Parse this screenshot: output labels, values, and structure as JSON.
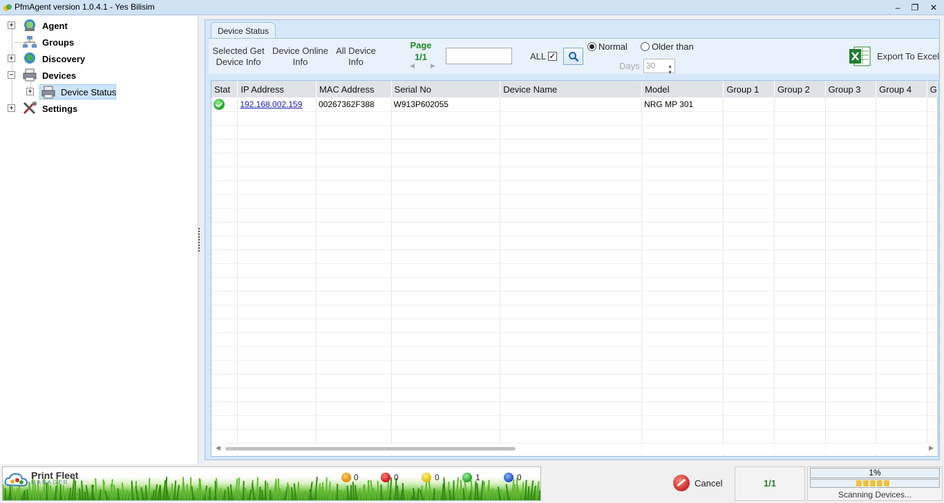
{
  "window": {
    "title": "PfmAgent version 1.0.4.1 - Yes Bilisim",
    "minimize": "–",
    "restore": "❐",
    "close": "✕"
  },
  "tree": [
    {
      "label": "Agent",
      "expander": "+"
    },
    {
      "label": "Groups"
    },
    {
      "label": "Discovery",
      "expander": "+"
    },
    {
      "label": "Devices",
      "expander": "−"
    },
    {
      "label": "Device Status",
      "expander": "+"
    },
    {
      "label": "Settings",
      "expander": "+"
    }
  ],
  "tab": {
    "label": "Device Status"
  },
  "toolbar": {
    "selected_get_1": "Selected Get",
    "selected_get_2": "Device Info",
    "device_online_1": "Device Online",
    "device_online_2": "Info",
    "all_device_1": "All Device",
    "all_device_2": "Info",
    "page_label": "Page",
    "page_value": "1/1",
    "page_prev": "◀",
    "page_next": "▶",
    "search_value": "",
    "all_label": "ALL",
    "all_checked": "✓",
    "normal_label": "Normal",
    "older_label": "Older than",
    "days_label": "Days",
    "days_value": "30",
    "export_label": "Export To Excel"
  },
  "grid": {
    "columns": [
      "Stat",
      "IP Address",
      "MAC Address",
      "Serial No",
      "Device Name",
      "Model",
      "Group 1",
      "Group 2",
      "Group 3",
      "Group 4",
      "G"
    ],
    "rows": [
      {
        "status": "ok",
        "ip": "192.168.002.159",
        "mac": "00267362F388",
        "serial": "W913P602055",
        "name": "",
        "model": "NRG MP 301",
        "g1": "",
        "g2": "",
        "g3": "",
        "g4": ""
      }
    ]
  },
  "statusbar": {
    "logo_title": "Print Fleet",
    "logo_sub": "MANAGER",
    "counts": [
      {
        "icon": "orange-minus-icon",
        "value": "0",
        "color": "#f0a020"
      },
      {
        "icon": "red-stop-icon",
        "value": "0",
        "color": "#d32020"
      },
      {
        "icon": "yellow-warning-icon",
        "value": "0",
        "color": "#f0d020"
      },
      {
        "icon": "green-ok-icon",
        "value": "1",
        "color": "#2fb02f"
      },
      {
        "icon": "blue-info-icon",
        "value": "0",
        "color": "#2060c8"
      }
    ],
    "cancel_label": "Cancel",
    "page_value": "1/1",
    "progress_pct": "1%",
    "scan_label": "Scanning Devices..."
  }
}
